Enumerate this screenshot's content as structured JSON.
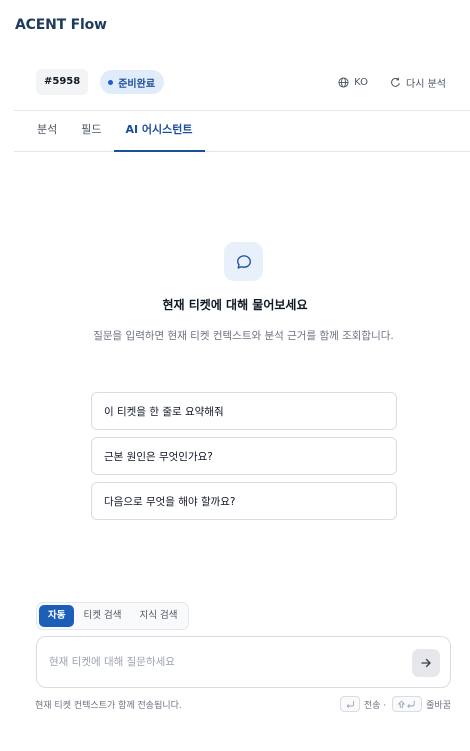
{
  "app": {
    "title": "ACENT Flow"
  },
  "ticket": {
    "id": "#5958",
    "status": "준비완료",
    "lang_label": "KO",
    "reanalyze_label": "다시 분석"
  },
  "tabs": [
    {
      "label": "분석",
      "active": false
    },
    {
      "label": "필드",
      "active": false
    },
    {
      "label": "AI 어시스턴트",
      "active": true
    }
  ],
  "empty_state": {
    "title": "현재 티켓에 대해 물어보세요",
    "description": "질문을 입력하면 현재 티켓 컨텍스트와 분석 근거를 함께 조회합니다."
  },
  "suggestions": [
    "이 티켓을 한 줄로 요약해줘",
    "근본 원인은 무엇인가요?",
    "다음으로 무엇을 해야 할까요?"
  ],
  "modes": [
    {
      "label": "자동",
      "active": true
    },
    {
      "label": "티켓 검색",
      "active": false
    },
    {
      "label": "지식 검색",
      "active": false
    }
  ],
  "composer": {
    "placeholder": "현재 티켓에 대해 질문하세요",
    "value": ""
  },
  "footer": {
    "note": "현재 티켓 컨텍스트가 함께 전송됩니다.",
    "send_key_label": "전송 ·",
    "newline_key_label": "줄바꿈"
  },
  "colors": {
    "accent": "#1d4e9e",
    "mode_active": "#1d5fb8",
    "icon_bg": "#e8f1fb"
  }
}
